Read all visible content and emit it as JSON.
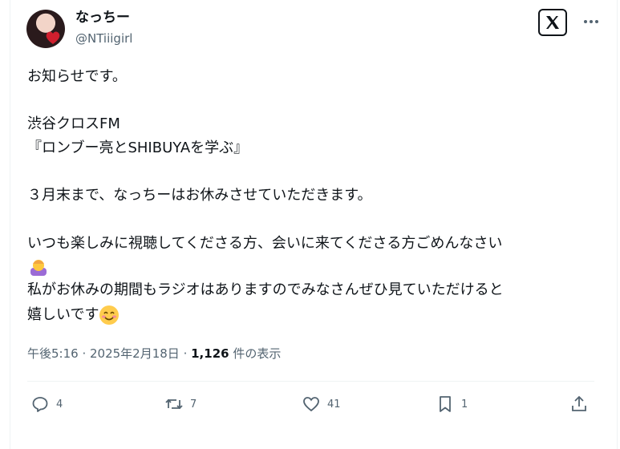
{
  "author": {
    "display_name": "なっちー",
    "handle": "@NTiiigirl"
  },
  "post": {
    "lines": [
      "お知らせです。",
      "渋谷クロスFM",
      "『ロンブー亮とSHIBUYAを学ぶ』",
      "３月末まで、なっちーはお休みさせていただきます。",
      "いつも楽しみに視聴してくださる方、会いに来てくださる方ごめんなさい",
      "私がお休みの期間もラジオはありますのでみなさんぜひ見ていただけると",
      "嬉しいです"
    ],
    "emoji": [
      "bowing-person-emoji",
      "smiling-face-emoji"
    ]
  },
  "meta": {
    "time": "午後5:16",
    "sep1": " · ",
    "date": "2025年2月18日",
    "sep2": " · ",
    "views_count": "1,126",
    "views_label": " 件の表示"
  },
  "actions": {
    "replies": "4",
    "reposts": "7",
    "likes": "41",
    "bookmarks": "1"
  },
  "colors": {
    "text": "#0f1419",
    "secondary": "#536471",
    "border": "#eff3f4"
  }
}
